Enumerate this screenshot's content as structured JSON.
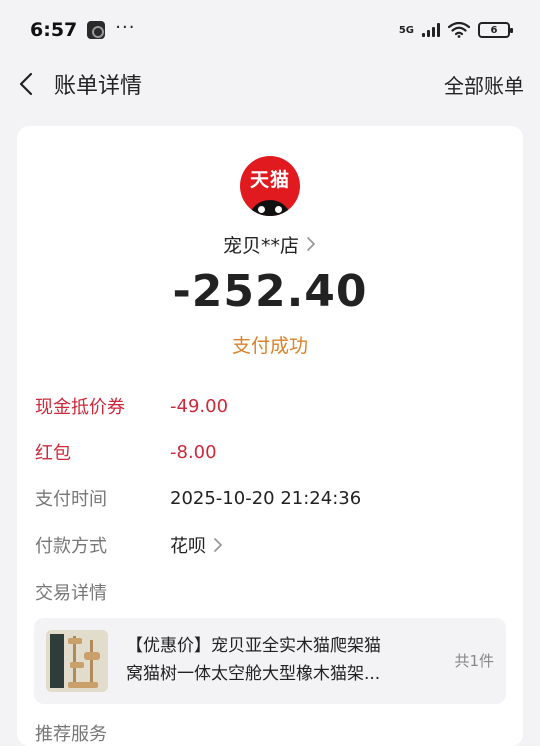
{
  "status_bar": {
    "time": "6:57",
    "dots": "···",
    "network": "5G",
    "battery": "6"
  },
  "nav": {
    "title": "账单详情",
    "action": "全部账单"
  },
  "merchant": {
    "logo_text": "天猫",
    "name": "宠贝**店"
  },
  "amount": "-252.40",
  "status": "支付成功",
  "details": [
    {
      "label": "现金抵价券",
      "value": "-49.00"
    },
    {
      "label": "红包",
      "value": "-8.00"
    },
    {
      "label": "支付时间",
      "value": "2025-10-20 21:24:36"
    },
    {
      "label": "付款方式",
      "value": "花呗"
    }
  ],
  "trade_section_label": "交易详情",
  "product": {
    "line1": "【优惠价】宠贝亚全实木猫爬架猫",
    "line2": "窝猫树一体太空舱大型橡木猫架...",
    "count": "共1件"
  },
  "more_section_label": "推荐服务",
  "colors": {
    "accent_red": "#cc2a3c",
    "status_orange": "#d9822b",
    "tmall_red": "#e11a1f"
  }
}
